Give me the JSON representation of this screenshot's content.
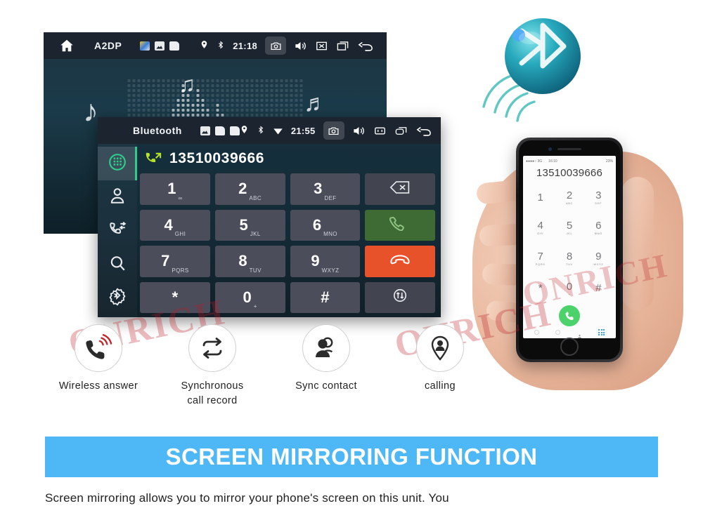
{
  "screen_music": {
    "status": {
      "home_icon": "home-icon",
      "title": "A2DP",
      "app_icons": [
        "media-app-icon",
        "gallery-app-icon",
        "file-app-icon"
      ],
      "location_icon": "location-pin-icon",
      "bluetooth_icon": "bluetooth-icon",
      "time": "21:18",
      "camera_icon": "camera-icon",
      "volume_icon": "volume-icon",
      "mute_icon": "mute-icon",
      "recent_icon": "recent-apps-icon",
      "back_icon": "back-arrow-icon"
    },
    "visualizer": {
      "note_glyph_1": "♪",
      "note_glyph_2": "♫",
      "note_glyph_3": "♬"
    }
  },
  "screen_dialer": {
    "status": {
      "home_icon": "home-icon",
      "title": "Bluetooth",
      "app_icons": [
        "media-app-icon",
        "lock-app-icon",
        "lock-app-icon"
      ],
      "location_icon": "location-pin-icon",
      "bluetooth_icon": "bluetooth-icon",
      "wifi_icon": "wifi-icon",
      "time": "21:55",
      "camera_icon": "camera-icon",
      "volume_icon": "volume-icon",
      "mute_icon": "mute-icon",
      "recent_icon": "recent-apps-icon",
      "back_icon": "back-arrow-icon"
    },
    "sidebar": [
      {
        "name": "dialpad",
        "icon": "dialpad-icon",
        "active": true
      },
      {
        "name": "contacts",
        "icon": "contact-person-icon",
        "active": false
      },
      {
        "name": "call-log",
        "icon": "call-log-icon",
        "active": false
      },
      {
        "name": "search",
        "icon": "search-icon",
        "active": false
      },
      {
        "name": "bluetooth-settings",
        "icon": "bluetooth-gear-icon",
        "active": false
      }
    ],
    "number": "13510039666",
    "call_state_icon": "outgoing-call-icon",
    "accent_green": "#2ecb8a",
    "keys": [
      {
        "digit": "1",
        "letters": "∞",
        "kind": "normal"
      },
      {
        "digit": "2",
        "letters": "ABC",
        "kind": "normal"
      },
      {
        "digit": "3",
        "letters": "DEF",
        "kind": "normal"
      },
      {
        "digit": "",
        "letters": "",
        "kind": "backspace",
        "icon": "backspace-icon"
      },
      {
        "digit": "4",
        "letters": "GHI",
        "kind": "normal"
      },
      {
        "digit": "5",
        "letters": "JKL",
        "kind": "normal"
      },
      {
        "digit": "6",
        "letters": "MNO",
        "kind": "normal"
      },
      {
        "digit": "",
        "letters": "",
        "kind": "call",
        "icon": "call-answer-icon"
      },
      {
        "digit": "7",
        "letters": "PQRS",
        "kind": "normal"
      },
      {
        "digit": "8",
        "letters": "TUV",
        "kind": "normal"
      },
      {
        "digit": "9",
        "letters": "WXYZ",
        "kind": "normal"
      },
      {
        "digit": "",
        "letters": "",
        "kind": "hangup",
        "icon": "call-end-icon"
      },
      {
        "digit": "*",
        "letters": "",
        "kind": "normal"
      },
      {
        "digit": "0",
        "letters": "+",
        "kind": "normal"
      },
      {
        "digit": "#",
        "letters": "",
        "kind": "normal"
      },
      {
        "digit": "",
        "letters": "",
        "kind": "transfer",
        "icon": "audio-transfer-icon"
      }
    ],
    "key_colors": {
      "normal": "#4b4d5a",
      "call": "#3d6b33",
      "hangup": "#e8522b"
    }
  },
  "bluetooth_logo": {
    "icon": "bluetooth-sphere-logo",
    "color": "#1f9bb5"
  },
  "phone": {
    "ios": {
      "carrier": "●●●●○  3G",
      "time": "16:10",
      "battery": "23%",
      "number": "13510039666",
      "keys": [
        {
          "d": "1",
          "l": ""
        },
        {
          "d": "2",
          "l": "ABC"
        },
        {
          "d": "3",
          "l": "DEF"
        },
        {
          "d": "4",
          "l": "GHI"
        },
        {
          "d": "5",
          "l": "JKL"
        },
        {
          "d": "6",
          "l": "MNO"
        },
        {
          "d": "7",
          "l": "PQRS"
        },
        {
          "d": "8",
          "l": "TUV"
        },
        {
          "d": "9",
          "l": "WXYZ"
        },
        {
          "d": "*",
          "l": ""
        },
        {
          "d": "0",
          "l": "+"
        },
        {
          "d": "#",
          "l": ""
        }
      ],
      "call_icon": "call-answer-icon",
      "contacts_tab_icon": "contact-person-icon",
      "keypad_tab_icon": "dialpad-icon"
    }
  },
  "features": [
    {
      "icon": "wireless-answer-icon",
      "label": "Wireless answer"
    },
    {
      "icon": "sync-loop-icon",
      "label": "Synchronous\ncall record"
    },
    {
      "icon": "sync-contact-icon",
      "label": "Sync contact"
    },
    {
      "icon": "calling-pin-icon",
      "label": "calling"
    }
  ],
  "watermark": {
    "text": "ONRICH",
    "color": "#be1e28"
  },
  "banner": {
    "title": "SCREEN MIRRORING FUNCTION",
    "bg_color": "#4db8f5"
  },
  "caption": {
    "text": "Screen mirroring allows you to mirror your phone's screen on this unit. You"
  }
}
